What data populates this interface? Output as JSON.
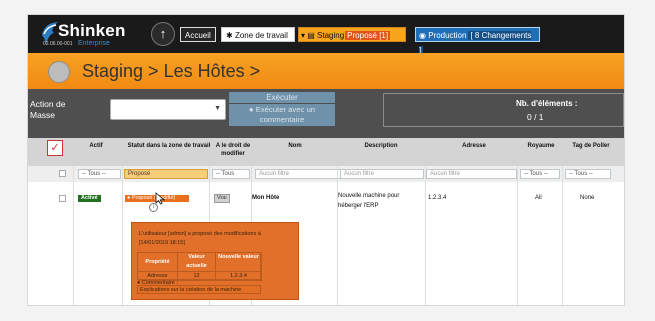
{
  "brand": {
    "name": "Shinken",
    "version": "02.06.00-001",
    "edition": "Enterprise"
  },
  "nav": {
    "home": "Accueil",
    "work": "Zone de travail",
    "staging": "Staging",
    "staging_badge": "Proposé [1]",
    "production": "Production",
    "production_badge": "[ 8 Changements ]"
  },
  "page": {
    "title": "Staging > Les Hôtes >"
  },
  "actions": {
    "label": "Action de Masse",
    "execute": "Exécuter",
    "execute_comment": "Exécuter avec un commentaire",
    "count_label": "Nb. d'éléments :",
    "count_value": "0 / 1"
  },
  "table": {
    "headers": {
      "actif": "Actif",
      "statut": "Statut dans la zone de travail",
      "droit": "A le droit de modifier",
      "nom": "Nom",
      "description": "Description",
      "adresse": "Adresse",
      "royaume": "Royaume",
      "tag": "Tag de Poller"
    },
    "filters": {
      "actif": "-- Tous --",
      "statut": "Proposé",
      "droit": "-- Tous",
      "nom": "Aucun filtre",
      "description": "Aucun filtre",
      "adresse": "Aucun filtre",
      "royaume": "-- Tous --",
      "tag": "-- Tous --"
    },
    "row": {
      "status": "Activé",
      "staging_status": "Proposé (modifié)",
      "can_modify": "Vrai",
      "name": "Mon Hôte",
      "description": "Nouvelle machine pour héberger l'ERP",
      "address": "1.2.3.4",
      "realm": "All",
      "poller_tag": "None"
    }
  },
  "popup": {
    "message": "L'utilisateur [admin] a proposé des modifications à [14/01/2019 18:15]",
    "property_header": "Propriété",
    "current_header": "Valeur actuelle",
    "new_header": "Nouvelle valeur",
    "property": "Adresse",
    "current": "12",
    "new": "1.2.3.4",
    "comment_label": "Commentaire :",
    "comment": "Explications sur la création de la machine"
  },
  "colors": {
    "orange": "#f18a14",
    "dark": "#1a1a1a",
    "blue": "#1f6fb8",
    "green": "#237023"
  },
  "icons": {
    "logo": "shinken-logo-icon",
    "up": "arrow-up-icon",
    "database": "database-icon"
  }
}
